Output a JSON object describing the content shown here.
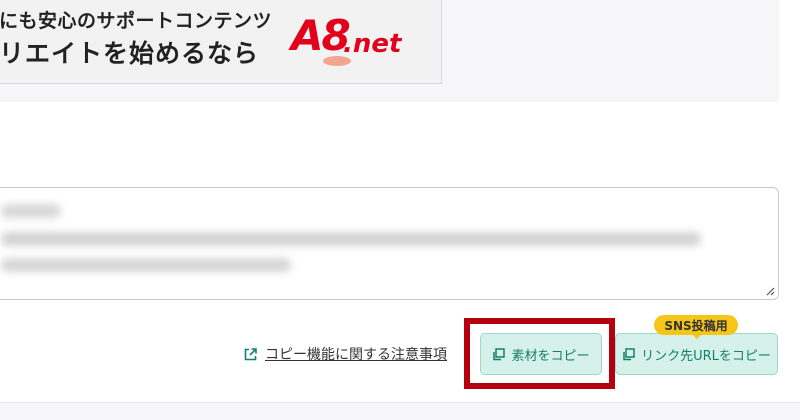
{
  "banner": {
    "line1": "にも安心のサポートコンテンツ",
    "line2": "リエイトを始めるなら",
    "logo_main": "A8",
    "logo_suffix": ".net"
  },
  "actions": {
    "notice_link": "コピー機能に関する注意事項",
    "copy_material_label": "素材をコピー",
    "copy_link_label": "リンク先URLをコピー",
    "sns_badge": "SNS投稿用"
  },
  "colors": {
    "accent_teal": "#14806a",
    "button_bg": "#d6f1ea",
    "badge_yellow": "#f5c518",
    "highlight_red": "#b5000f",
    "logo_red": "#e3001b"
  },
  "icons": {
    "notice_link": "external-link-icon",
    "copy_material": "copy-icon",
    "copy_link": "copy-icon",
    "textarea_resize": "resize-grip-icon"
  }
}
